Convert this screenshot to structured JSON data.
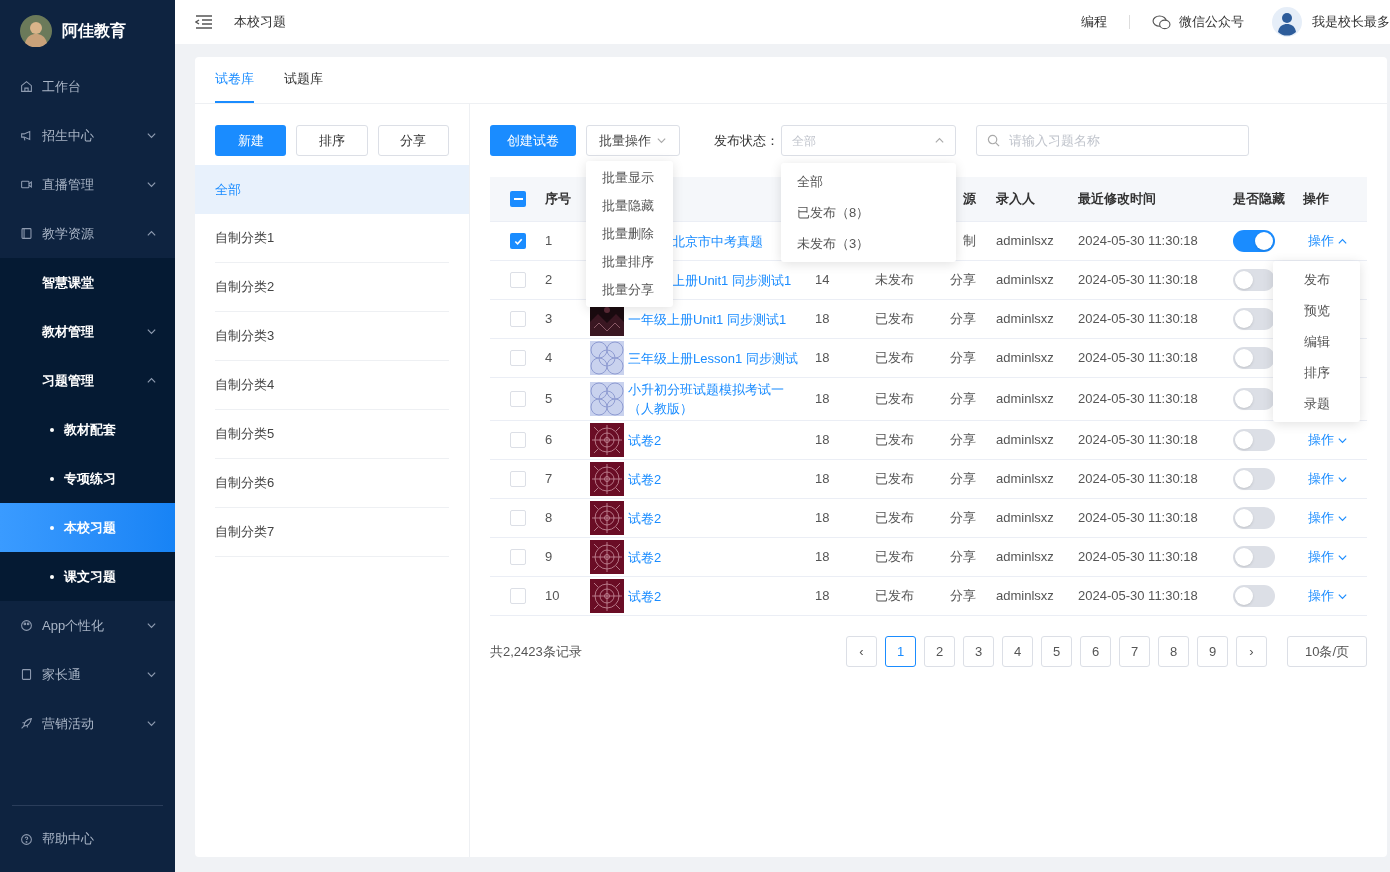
{
  "sidebar": {
    "brand": "阿佳教育",
    "items": [
      {
        "label": "工作台",
        "selected": false
      },
      {
        "label": "招生中心",
        "expanded": false,
        "selected": false
      },
      {
        "label": "直播管理",
        "expanded": false,
        "selected": false
      },
      {
        "label": "教学资源",
        "expanded": true,
        "selected": false,
        "children": [
          {
            "label": "智慧课堂",
            "selected": false
          },
          {
            "label": "教材管理",
            "expanded": false,
            "selected": false
          },
          {
            "label": "习题管理",
            "expanded": true,
            "selected": false,
            "children": [
              {
                "label": "教材配套",
                "selected": false
              },
              {
                "label": "专项练习",
                "selected": false
              },
              {
                "label": "本校习题",
                "selected": true
              },
              {
                "label": "课文习题",
                "selected": false
              }
            ]
          }
        ]
      },
      {
        "label": "App个性化",
        "expanded": false,
        "selected": false
      },
      {
        "label": "家长通",
        "expanded": false,
        "selected": false
      },
      {
        "label": "营销活动",
        "expanded": false,
        "selected": false
      }
    ],
    "footer": {
      "label": "帮助中心"
    }
  },
  "topbar": {
    "breadcrumb": "本校习题",
    "link": "编程",
    "wechat": "微信公众号",
    "user": "我是校长最多"
  },
  "tabs": [
    {
      "label": "试卷库",
      "selected": true
    },
    {
      "label": "试题库",
      "selected": false
    }
  ],
  "category_buttons": [
    {
      "label": "新建",
      "primary": true
    },
    {
      "label": "排序",
      "primary": false
    },
    {
      "label": "分享",
      "primary": false
    }
  ],
  "categories": [
    {
      "label": "全部",
      "selected": true
    },
    {
      "label": "自制分类1",
      "selected": false
    },
    {
      "label": "自制分类2",
      "selected": false
    },
    {
      "label": "自制分类3",
      "selected": false
    },
    {
      "label": "自制分类4",
      "selected": false
    },
    {
      "label": "自制分类5",
      "selected": false
    },
    {
      "label": "自制分类6",
      "selected": false
    },
    {
      "label": "自制分类7",
      "selected": false
    }
  ],
  "toolbar": {
    "create": "创建试卷",
    "batch": {
      "label": "批量操作",
      "options": [
        "批量显示",
        "批量隐藏",
        "批量删除",
        "批量排序",
        "批量分享"
      ]
    },
    "status_label": "发布状态：",
    "status": {
      "placeholder": "全部",
      "expanded": true,
      "options": [
        "全部",
        "已发布（8）",
        "未发布（3）"
      ]
    },
    "search": {
      "placeholder": "请输入习题名称"
    }
  },
  "table": {
    "header": {
      "select_all": {
        "indeterminate": true
      },
      "index": "序号",
      "source": "源",
      "entered_by": "录入人",
      "modified": "最近修改时间",
      "hidden": "是否隐藏",
      "actions": "操作"
    },
    "rows": [
      {
        "checked": true,
        "index": "1",
        "name": "北京市中考真题",
        "source": "制",
        "entered_by": "adminlsxz",
        "modified": "2024-05-30 11:30:18",
        "hidden": true,
        "action": {
          "label": "操作",
          "expanded": true,
          "options": [
            "发布",
            "预览",
            "编辑",
            "排序",
            "录题"
          ]
        }
      },
      {
        "checked": false,
        "index": "2",
        "name": "上册Unit1 同步测试1",
        "count": "14",
        "status": "未发布",
        "source": "分享",
        "entered_by": "adminlsxz",
        "modified": "2024-05-30 11:30:18",
        "hidden": false
      },
      {
        "checked": false,
        "index": "3",
        "cover": true,
        "name": "一年级上册Unit1 同步测试1",
        "count": "18",
        "status": "已发布",
        "source": "分享",
        "entered_by": "adminlsxz",
        "modified": "2024-05-30 11:30:18",
        "hidden": false
      },
      {
        "checked": false,
        "index": "4",
        "cover": true,
        "name": "三年级上册Lesson1 同步测试",
        "count": "18",
        "status": "已发布",
        "source": "分享",
        "entered_by": "adminlsxz",
        "modified": "2024-05-30 11:30:18",
        "hidden": false
      },
      {
        "checked": false,
        "index": "5",
        "cover": true,
        "name": "小升初分班试题模拟考试一（人教版）",
        "count": "18",
        "status": "已发布",
        "source": "分享",
        "entered_by": "adminlsxz",
        "modified": "2024-05-30 11:30:18",
        "hidden": false
      },
      {
        "checked": false,
        "index": "6",
        "cover": true,
        "name": "试卷2",
        "count": "18",
        "status": "已发布",
        "source": "分享",
        "entered_by": "adminlsxz",
        "modified": "2024-05-30 11:30:18",
        "hidden": false,
        "action": {
          "label": "操作",
          "expanded": false
        }
      },
      {
        "checked": false,
        "index": "7",
        "cover": true,
        "name": "试卷2",
        "count": "18",
        "status": "已发布",
        "source": "分享",
        "entered_by": "adminlsxz",
        "modified": "2024-05-30 11:30:18",
        "hidden": false,
        "action": {
          "label": "操作",
          "expanded": false
        }
      },
      {
        "checked": false,
        "index": "8",
        "cover": true,
        "name": "试卷2",
        "count": "18",
        "status": "已发布",
        "source": "分享",
        "entered_by": "adminlsxz",
        "modified": "2024-05-30 11:30:18",
        "hidden": false,
        "action": {
          "label": "操作",
          "expanded": false
        }
      },
      {
        "checked": false,
        "index": "9",
        "cover": true,
        "name": "试卷2",
        "count": "18",
        "status": "已发布",
        "source": "分享",
        "entered_by": "adminlsxz",
        "modified": "2024-05-30 11:30:18",
        "hidden": false,
        "action": {
          "label": "操作",
          "expanded": false
        }
      },
      {
        "checked": false,
        "index": "10",
        "cover": true,
        "name": "试卷2",
        "count": "18",
        "status": "已发布",
        "source": "分享",
        "entered_by": "adminlsxz",
        "modified": "2024-05-30 11:30:18",
        "hidden": false,
        "action": {
          "label": "操作",
          "expanded": false
        }
      }
    ]
  },
  "pagination": {
    "total": "共2,2423条记录",
    "prev": "‹",
    "next": "›",
    "pages": [
      {
        "label": "1",
        "selected": true
      },
      {
        "label": "2",
        "selected": false
      },
      {
        "label": "3",
        "selected": false
      },
      {
        "label": "4",
        "selected": false
      },
      {
        "label": "5",
        "selected": false
      },
      {
        "label": "6",
        "selected": false
      },
      {
        "label": "7",
        "selected": false
      },
      {
        "label": "8",
        "selected": false
      },
      {
        "label": "9",
        "selected": false
      }
    ],
    "page_size": "10条/页"
  }
}
